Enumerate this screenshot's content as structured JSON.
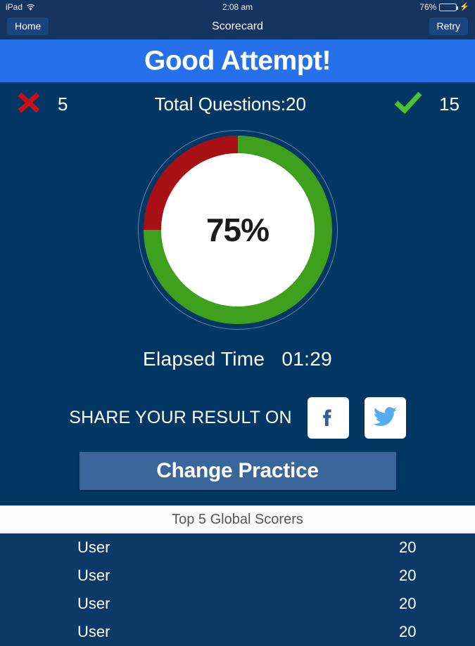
{
  "status_bar": {
    "device": "iPad",
    "wifi_icon": "wifi-icon",
    "time": "2:08 am",
    "battery_percent": "76%",
    "battery_icon": "battery-icon",
    "charging_icon": "lightning-bolt-icon"
  },
  "nav": {
    "home_label": "Home",
    "title": "Scorecard",
    "retry_label": "Retry"
  },
  "banner": {
    "message": "Good Attempt!",
    "color": "#2670ea"
  },
  "stats": {
    "wrong_icon": "x-mark-icon",
    "wrong_count": "5",
    "total_label": "Total Questions:20",
    "correct_icon": "check-mark-icon",
    "correct_count": "15"
  },
  "score_circle": {
    "percent_label": "75%",
    "correct_color": "#3fa01e",
    "wrong_color": "#a81016",
    "hole_color": "#ffffff"
  },
  "elapsed": {
    "label": "Elapsed Time",
    "value": "01:29"
  },
  "share": {
    "label": "SHARE YOUR RESULT ON",
    "facebook_icon": "facebook-icon",
    "facebook_color": "#3b5998",
    "twitter_icon": "twitter-icon",
    "twitter_color": "#55acee"
  },
  "cta": {
    "label": "Change Practice",
    "color": "#3a6699"
  },
  "leaderboard": {
    "title": "Top 5 Global Scorers",
    "rows": [
      {
        "name": "User",
        "score": "20"
      },
      {
        "name": "User",
        "score": "20"
      },
      {
        "name": "User",
        "score": "20"
      },
      {
        "name": "User",
        "score": "20"
      }
    ]
  },
  "chart_data": {
    "type": "pie",
    "title": "Quiz Score",
    "categories": [
      "Correct",
      "Incorrect"
    ],
    "values": [
      15,
      5
    ],
    "percentages": [
      75,
      25
    ],
    "colors": [
      "#3fa01e",
      "#a81016"
    ],
    "center_label": "75%",
    "total": 20,
    "start_angle_deg": 0,
    "direction": "clockwise",
    "legend": "none"
  }
}
